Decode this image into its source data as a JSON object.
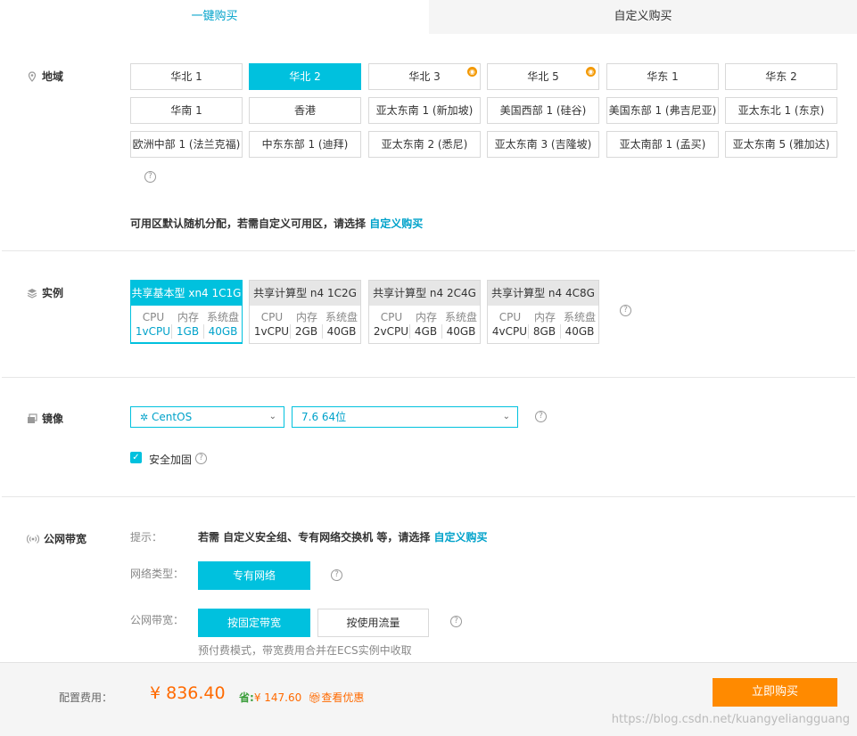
{
  "tabs": [
    {
      "label": "一键购买"
    },
    {
      "label": "自定义购买"
    }
  ],
  "region": {
    "label": "地域",
    "rows": [
      [
        {
          "name": "华北 1"
        },
        {
          "name": "华北 2"
        },
        {
          "name": "华北 3"
        },
        {
          "name": "华北 5"
        },
        {
          "name": "华东 1"
        },
        {
          "name": "华东 2"
        }
      ],
      [
        {
          "name": "华南 1"
        },
        {
          "name": "香港"
        },
        {
          "name": "亚太东南 1 (新加坡)"
        },
        {
          "name": "美国西部 1 (硅谷)"
        },
        {
          "name": "美国东部 1 (弗吉尼亚)"
        },
        {
          "name": "亚太东北 1 (东京)"
        }
      ],
      [
        {
          "name": "欧洲中部 1 (法兰克福)"
        },
        {
          "name": "中东东部 1 (迪拜)"
        },
        {
          "name": "亚太东南 2 (悉尼)"
        },
        {
          "name": "亚太东南 3 (吉隆坡)"
        },
        {
          "name": "亚太南部 1 (孟买)"
        },
        {
          "name": "亚太东南 5 (雅加达)"
        }
      ]
    ],
    "selected": "华北 2",
    "zone_tip": "可用区默认随机分配，若需自定义可用区，请选择",
    "zone_tip_link": "自定义购买"
  },
  "instance": {
    "label": "实例",
    "selected": "共享基本型 xn4 1C1G",
    "specs": [
      {
        "name": "共享基本型 xn4 1C1G",
        "cpu": "1vCPU",
        "mem": "1GB",
        "disk": "40GB"
      },
      {
        "name": "共享计算型 n4 1C2G",
        "cpu": "1vCPU",
        "mem": "2GB",
        "disk": "40GB"
      },
      {
        "name": "共享计算型 n4 2C4G",
        "cpu": "2vCPU",
        "mem": "4GB",
        "disk": "40GB"
      },
      {
        "name": "共享计算型 n4 4C8G",
        "cpu": "4vCPU",
        "mem": "8GB",
        "disk": "40GB"
      }
    ],
    "col_cpu": "CPU",
    "col_mem": "内存",
    "col_disk": "系统盘"
  },
  "image": {
    "label": "镜像",
    "os": "CentOS",
    "version": "7.6 64位",
    "security_label": "安全加固",
    "security_checked": true
  },
  "bandwidth": {
    "label": "公网带宽",
    "tip_label": "提示：",
    "tip_text": "若需 自定义安全组、专有网络交换机 等，请选择",
    "tip_link": "自定义购买",
    "network_label": "网络类型：",
    "network_value": "专有网络",
    "bw_label": "公网带宽：",
    "bw_fixed": "按固定带宽",
    "bw_traffic": "按使用流量",
    "bw_note": "预付费模式，带宽费用合并在ECS实例中收取"
  },
  "footer": {
    "cost_label": "配置费用：",
    "price": "¥ 836.40",
    "save_prefix": "省:",
    "save_amount": "¥ 147.60",
    "discount_link": "查看优惠",
    "buy_button": "立即购买",
    "watermark": "https://blog.csdn.net/kuangyeliangguang"
  },
  "colors": {
    "accent": "#00c1de",
    "link": "#00a2ca",
    "price": "#ff6a00",
    "buy": "#ff8a00"
  }
}
